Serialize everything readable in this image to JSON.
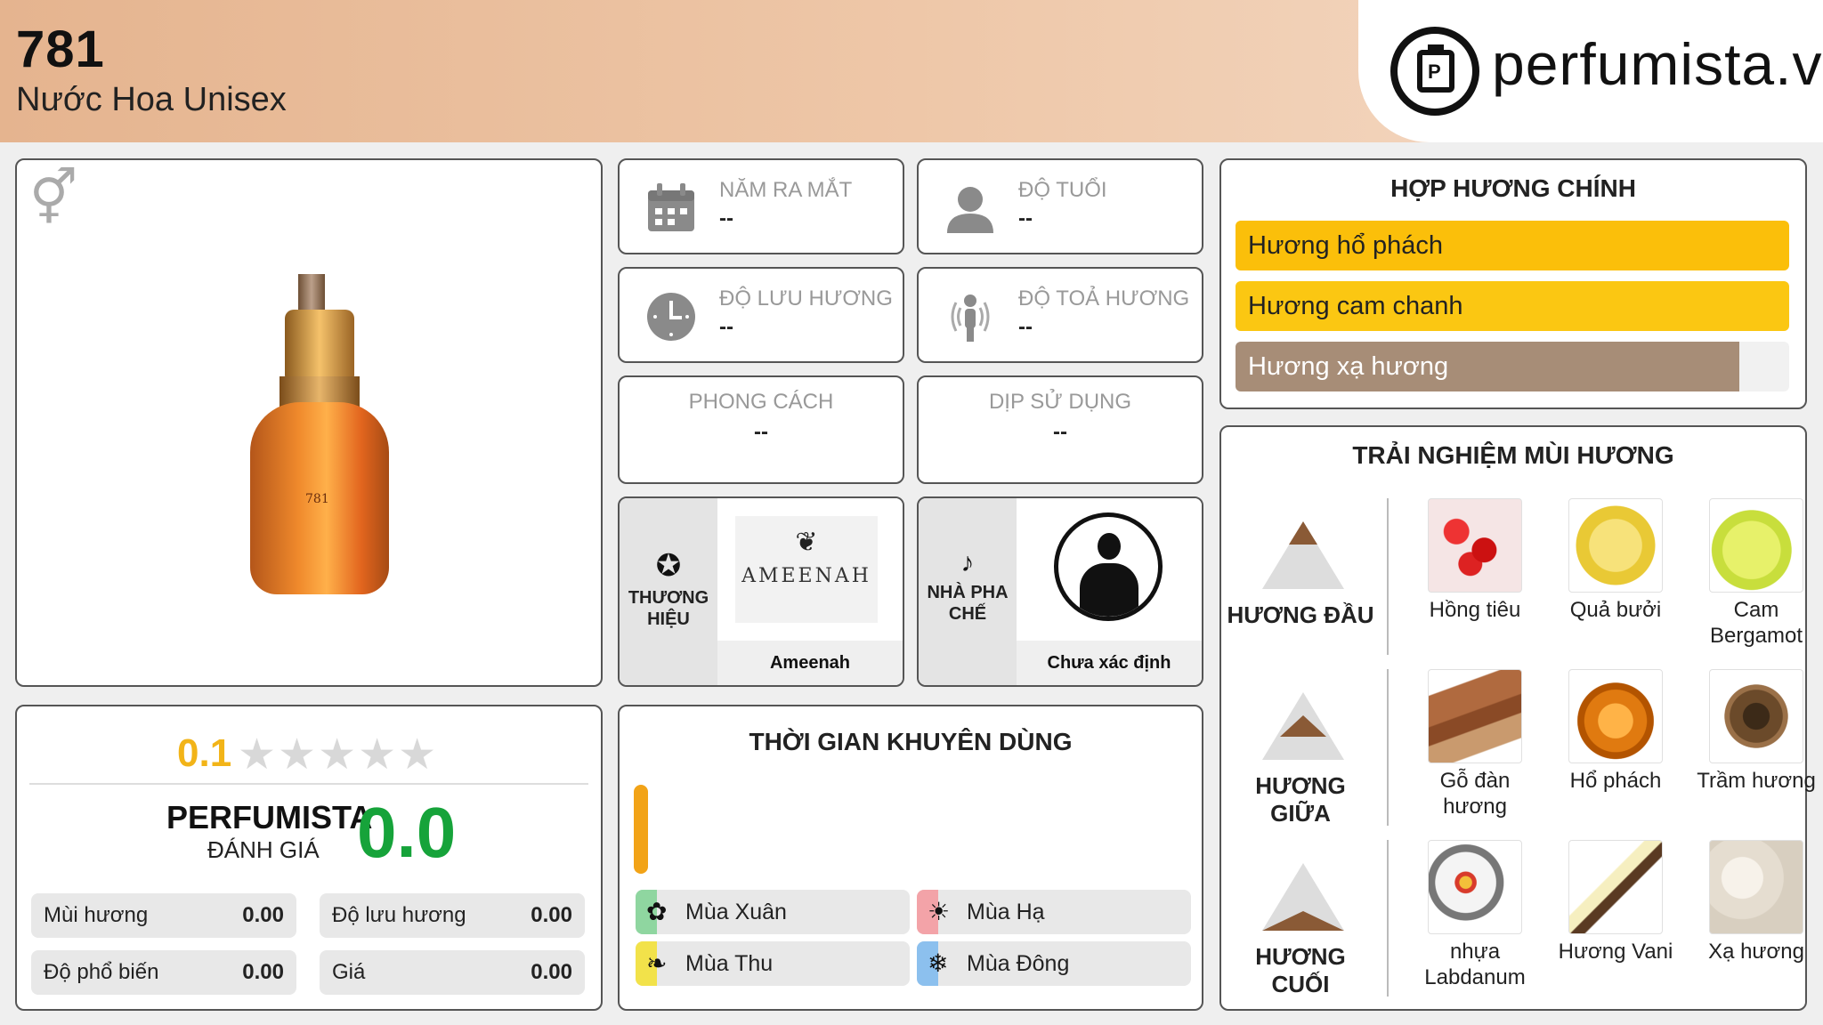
{
  "header": {
    "product_name": "781",
    "product_type": "Nước Hoa Unisex",
    "logo_text": "perfumista.vn"
  },
  "product_image": {
    "gender_icon": "unisex-symbol-icon",
    "bottle_label": "781"
  },
  "info_cards": {
    "release_year": {
      "label": "NĂM RA MẮT",
      "value": "--",
      "icon": "calendar-icon"
    },
    "age": {
      "label": "ĐỘ TUỔI",
      "value": "--",
      "icon": "user-icon"
    },
    "longevity": {
      "label": "ĐỘ LƯU HƯƠNG",
      "value": "--",
      "icon": "clock-icon"
    },
    "sillage": {
      "label": "ĐỘ TOẢ HƯƠNG",
      "value": "--",
      "icon": "radiate-person-icon"
    },
    "style": {
      "label": "PHONG CÁCH",
      "value": "--"
    },
    "occasion": {
      "label": "DỊP SỬ DỤNG",
      "value": "--"
    }
  },
  "brand": {
    "label": "THƯƠNG HIỆU",
    "name": "Ameenah",
    "logo_text": "AMEENAH",
    "icon": "star-circle-icon"
  },
  "perfumer": {
    "label": "NHÀ PHA CHẾ",
    "name": "Chưa xác định",
    "icon": "nose-icon"
  },
  "rating": {
    "user_score": "0.1",
    "stars": "★★★★★",
    "perfumista_title": "PERFUMISTA",
    "perfumista_sub": "ĐÁNH GIÁ",
    "perfumista_score": "0.0",
    "metrics": [
      {
        "label": "Mùi hương",
        "value": "0.00"
      },
      {
        "label": "Độ lưu hương",
        "value": "0.00"
      },
      {
        "label": "Độ phổ biến",
        "value": "0.00"
      },
      {
        "label": "Giá",
        "value": "0.00"
      }
    ]
  },
  "recommended_time": {
    "title": "THỜI GIAN KHUYÊN DÙNG",
    "seasons": [
      {
        "label": "Mùa Xuân",
        "icon": "flower-icon",
        "color": "#8fd6a0"
      },
      {
        "label": "Mùa Hạ",
        "icon": "sun-icon",
        "color": "#f3a3a8"
      },
      {
        "label": "Mùa Thu",
        "icon": "leaf-icon",
        "color": "#f2e24a"
      },
      {
        "label": "Mùa Đông",
        "icon": "snowflake-icon",
        "color": "#8cc0ee"
      }
    ],
    "accent_color": "#f2a317"
  },
  "main_accords": {
    "title": "HỢP HƯƠNG CHÍNH",
    "items": [
      {
        "label": "Hương hổ phách",
        "level": 100,
        "color": "#fbbf0a"
      },
      {
        "label": "Hương cam chanh",
        "level": 100,
        "color": "#fbc712"
      },
      {
        "label": "Hương xạ hương",
        "level": 91,
        "color": "#a78d77"
      }
    ]
  },
  "scent_experience": {
    "title": "TRẢI NGHIỆM MÙI HƯƠNG",
    "rows": [
      {
        "label": "HƯƠNG ĐẦU",
        "notes": [
          "Hồng tiêu",
          "Quả bưởi",
          "Cam Bergamot"
        ]
      },
      {
        "label": "HƯƠNG GIỮA",
        "notes": [
          "Gỗ đàn hương",
          "Hổ phách",
          "Trầm hương"
        ]
      },
      {
        "label": "HƯƠNG CUỐI",
        "notes": [
          "nhựa Labdanum",
          "Hương Vani",
          "Xạ hương"
        ]
      }
    ]
  }
}
